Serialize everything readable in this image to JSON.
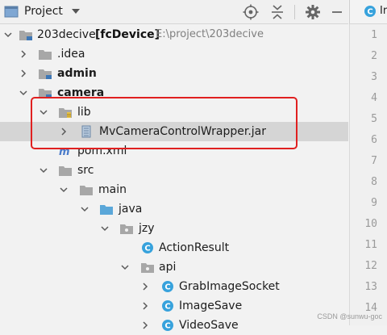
{
  "header": {
    "title": "Project",
    "icons": [
      "project-icon",
      "target-icon",
      "collapse-icon",
      "gear-icon",
      "minimize-icon"
    ]
  },
  "editor": {
    "tab_label": "Ir",
    "line_numbers": [
      "1",
      "2",
      "3",
      "4",
      "5",
      "6",
      "7",
      "8",
      "9",
      "10",
      "11",
      "12",
      "13",
      "14"
    ]
  },
  "tree": {
    "root": {
      "label": "203decive",
      "module": "[fcDevice]",
      "path": "E:\\project\\203decive"
    },
    "idea": ".idea",
    "admin": "admin",
    "camera": "camera",
    "lib": "lib",
    "jar": "MvCameraControlWrapper.jar",
    "pom": "pom.xml",
    "src": "src",
    "main": "main",
    "java": "java",
    "jzy": "jzy",
    "action_result": "ActionResult",
    "api": "api",
    "grab": "GrabImageSocket",
    "image_save": "ImageSave",
    "video_save": "VideoSave"
  },
  "colors": {
    "folder": "#a7a7a7",
    "source_folder": "#5aa7d9",
    "class_icon": "#37a2dc",
    "highlight_box": "#e02020",
    "selection": "#d5d5d5"
  },
  "watermark": "CSDN @sunwu-goc"
}
